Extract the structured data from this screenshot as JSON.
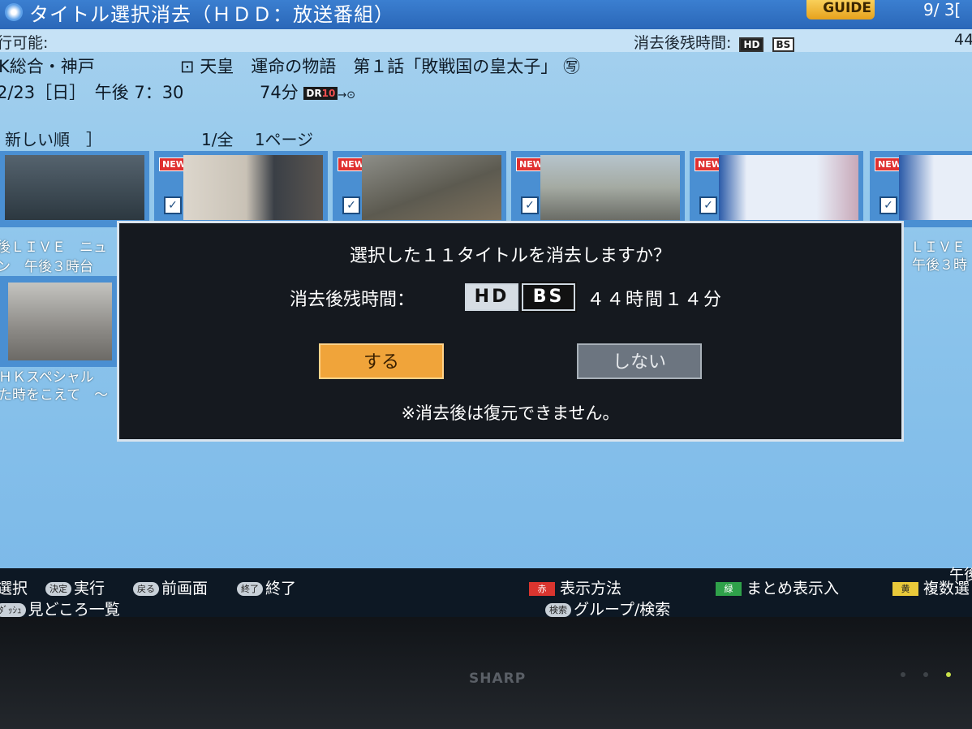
{
  "header": {
    "title": "タイトル選択消去（ＨＤＤ：放送番組）",
    "guide_logo": "GUIDE",
    "date": "9/ 3[",
    "info_left": "行可能:",
    "info_right_label": "消去後残時間:",
    "info_right_tag_hd": "HD",
    "info_right_tag_bs": "BS",
    "info_right_num": "44"
  },
  "program": {
    "channel": "K総合・神戸",
    "title": "天皇　運命の物語　第１話「敗戦国の皇太子」",
    "title_icon_left": "⊡",
    "title_icon_right": "㊢",
    "date": "2/23［日］　午後 7：30",
    "duration": "74分",
    "dr_label": "DR",
    "dr_count": "10",
    "dr_arrow": "→⊙"
  },
  "list": {
    "sort": "新しい順　］",
    "page": "1/全　 1ページ",
    "thumbnails": [
      {
        "new": "",
        "checked": "✓"
      },
      {
        "new": "NEW",
        "checked": "✓"
      },
      {
        "new": "NEW",
        "checked": "✓"
      },
      {
        "new": "NEW",
        "checked": "✓"
      },
      {
        "new": "NEW",
        "checked": "✓"
      },
      {
        "new": "NEW",
        "checked": "✓"
      }
    ],
    "caption1_line1": "後ＬＩＶＥ　ニュ",
    "caption1_line2": "ン　午後３時台",
    "caption_right_line1": "ＬＩＶＥ",
    "caption_right_line2": "午後３時",
    "caption2_line1": "ＨＫスペシャル",
    "caption2_line2": "た時をこえて　～"
  },
  "dialog": {
    "question": "選択した１１タイトルを消去しますか？",
    "remain_label": "消去後残時間：",
    "badge_hd": "HD",
    "badge_bs": "BS",
    "remain_time": "４４時間１４分",
    "yes": "する",
    "no": "しない",
    "warning": "※消去後は復元できません。"
  },
  "footer": {
    "select": "選択",
    "ok_key": "決定",
    "ok": "実行",
    "back_key": "戻る",
    "back": "前画面",
    "end_key": "終了",
    "end": "終了",
    "red_key": "赤",
    "red": "表示方法",
    "green_key": "緑",
    "green": "まとめ表示入",
    "yellow_key": "黄",
    "yellow": "複数選",
    "search_key": "検索",
    "search": "グループ/検索",
    "highlight_key": "ﾀﾞｯｼｭ",
    "highlight": "見どころ一覧",
    "corner": "午後"
  },
  "bezel": {
    "brand": "SHARP"
  },
  "colors": {
    "screen_bg": "#8fc6ec",
    "dialog_bg": "#15191f",
    "yes_button": "#f0a43a",
    "no_button": "#6c7580"
  }
}
